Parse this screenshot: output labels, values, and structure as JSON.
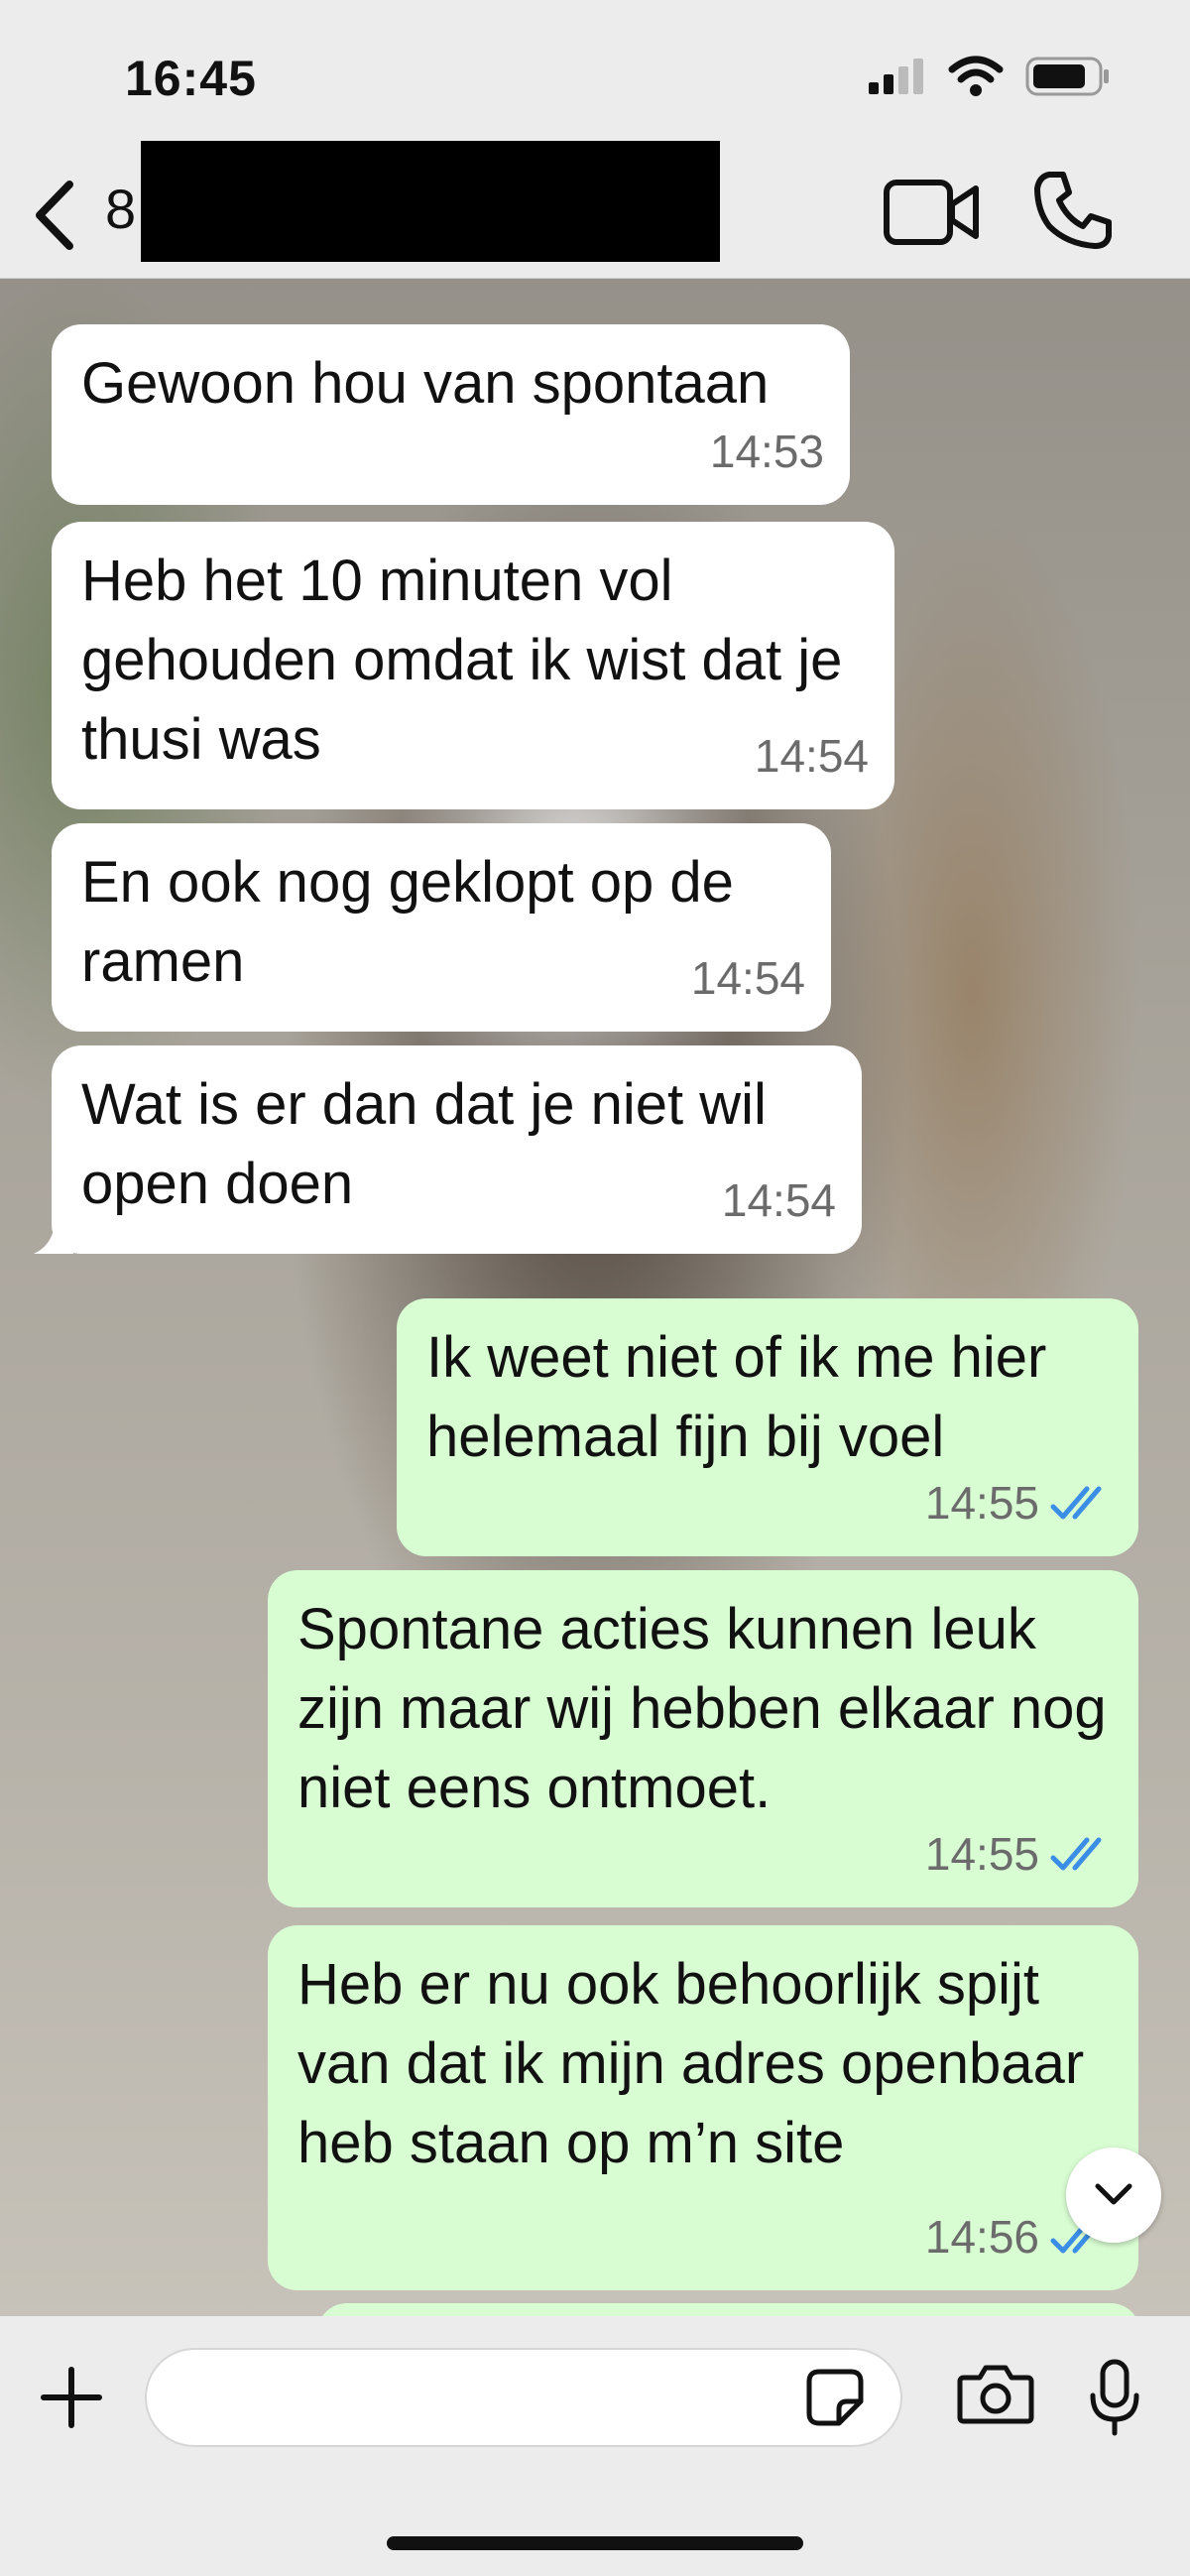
{
  "status_bar": {
    "time": "16:45"
  },
  "header": {
    "contact_initial": "8"
  },
  "messages": [
    {
      "direction": "in",
      "text": "Gewoon hou van spontaan",
      "time": "14:53"
    },
    {
      "direction": "in",
      "text": "Heb het 10 minuten vol gehouden omdat ik wist dat je thusi was",
      "time": "14:54"
    },
    {
      "direction": "in",
      "text": "En ook nog geklopt op de ramen",
      "time": "14:54"
    },
    {
      "direction": "in",
      "text": "Wat is er dan dat je niet wil open doen",
      "time": "14:54"
    },
    {
      "direction": "out",
      "text": "Ik weet niet of ik me hier helemaal fijn bij voel",
      "time": "14:55",
      "status": "read"
    },
    {
      "direction": "out",
      "text": "Spontane acties kunnen leuk zijn maar wij hebben elkaar nog niet eens ontmoet.",
      "time": "14:55",
      "status": "read"
    },
    {
      "direction": "out",
      "text": "Heb er nu ook behoorlijk spijt van dat ik mijn adres openbaar heb staan op m’n site",
      "time": "14:56",
      "status": "read"
    }
  ],
  "input": {
    "placeholder": ""
  },
  "icons": {
    "back": "chevron-left-icon",
    "video": "video-camera-icon",
    "call": "phone-icon",
    "plus": "plus-icon",
    "sticker": "sticker-icon",
    "camera": "camera-icon",
    "mic": "microphone-icon",
    "scroll": "chevron-down-icon",
    "read_receipt": "double-check-icon"
  },
  "colors": {
    "incoming_bubble": "#ffffff",
    "outgoing_bubble": "#d9fdd3",
    "read_tick": "#3a8ee6",
    "bar": "#ececec"
  }
}
